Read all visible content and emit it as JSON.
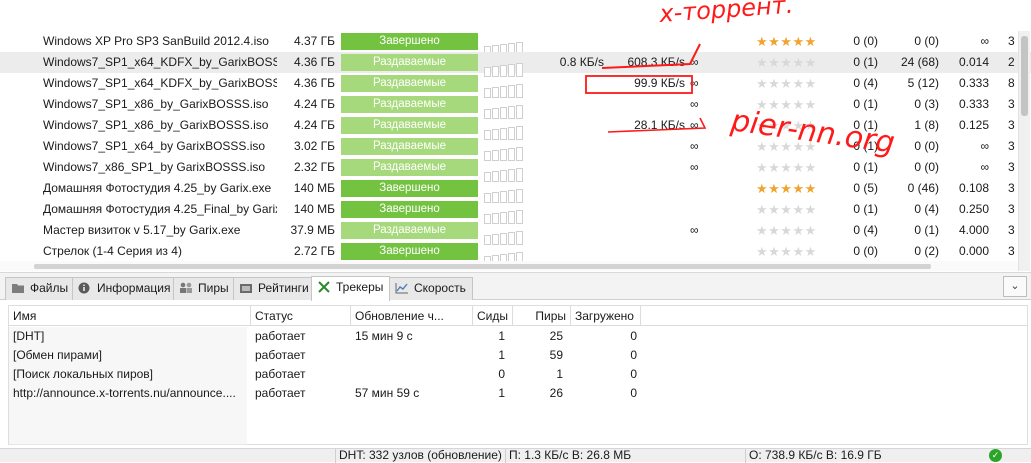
{
  "torrents": [
    {
      "name": "Windows XP Pro SP3 SanBuild 2012.4.iso",
      "size": "4.37 ГБ",
      "status": "Завершено",
      "status_kind": "done",
      "down": "",
      "up": "",
      "eta": "",
      "rating": "★★★★★",
      "rating_on": true,
      "seeds": "0 (0)",
      "peers": "0 (0)",
      "ratio": "∞",
      "extra": "3"
    },
    {
      "name": "Windows7_SP1_x64_KDFX_by_GarixBOSSS.iso",
      "size": "4.36 ГБ",
      "status": "Раздаваемые",
      "status_kind": "seed",
      "down": "0.8 КБ/s",
      "up": "608.3 КБ/s",
      "eta": "∞",
      "rating": "★★★★★",
      "rating_on": false,
      "seeds": "0 (1)",
      "peers": "24 (68)",
      "ratio": "0.014",
      "extra": "2"
    },
    {
      "name": "Windows7_SP1_x64_KDFX_by_GarixBOSSS.iso",
      "size": "4.36 ГБ",
      "status": "Раздаваемые",
      "status_kind": "seed",
      "down": "",
      "up": "99.9 КБ/s",
      "eta": "∞",
      "rating": "★★★★★",
      "rating_on": false,
      "seeds": "0 (4)",
      "peers": "5 (12)",
      "ratio": "0.333",
      "extra": "8"
    },
    {
      "name": "Windows7_SP1_x86_by_GarixBOSSS.iso",
      "size": "4.24 ГБ",
      "status": "Раздаваемые",
      "status_kind": "seed",
      "down": "",
      "up": "",
      "eta": "∞",
      "rating": "★★★★★",
      "rating_on": false,
      "seeds": "0 (1)",
      "peers": "0 (3)",
      "ratio": "0.333",
      "extra": "3"
    },
    {
      "name": "Windows7_SP1_x86_by_GarixBOSSS.iso",
      "size": "4.24 ГБ",
      "status": "Раздаваемые",
      "status_kind": "seed",
      "down": "",
      "up": "28.1 КБ/s",
      "eta": "∞",
      "rating": "★★★★★",
      "rating_on": false,
      "seeds": "0 (1)",
      "peers": "1 (8)",
      "ratio": "0.125",
      "extra": "3"
    },
    {
      "name": "Windows7_SP1_x64_by GarixBOSSS.iso",
      "size": "3.02 ГБ",
      "status": "Раздаваемые",
      "status_kind": "seed",
      "down": "",
      "up": "",
      "eta": "∞",
      "rating": "★★★★★",
      "rating_on": false,
      "seeds": "0 (1)",
      "peers": "0 (0)",
      "ratio": "∞",
      "extra": "3"
    },
    {
      "name": "Windows7_x86_SP1_by GarixBOSSS.iso",
      "size": "2.32 ГБ",
      "status": "Раздаваемые",
      "status_kind": "seed",
      "down": "",
      "up": "",
      "eta": "∞",
      "rating": "★★★★★",
      "rating_on": false,
      "seeds": "0 (1)",
      "peers": "0 (0)",
      "ratio": "∞",
      "extra": "3"
    },
    {
      "name": "Домашняя Фотостудия 4.25_by Garix.exe",
      "size": "140 МБ",
      "status": "Завершено",
      "status_kind": "done",
      "down": "",
      "up": "",
      "eta": "",
      "rating": "★★★★★",
      "rating_on": true,
      "seeds": "0 (5)",
      "peers": "0 (46)",
      "ratio": "0.108",
      "extra": "3"
    },
    {
      "name": "Домашняя Фотостудия 4.25_Final_by Garix.exe",
      "size": "140 МБ",
      "status": "Завершено",
      "status_kind": "done",
      "down": "",
      "up": "",
      "eta": "",
      "rating": "★★★★★",
      "rating_on": false,
      "seeds": "0 (1)",
      "peers": "0 (4)",
      "ratio": "0.250",
      "extra": "3"
    },
    {
      "name": "Мастер визиток v 5.17_by Garix.exe",
      "size": "37.9 МБ",
      "status": "Раздаваемые",
      "status_kind": "seed",
      "down": "",
      "up": "",
      "eta": "∞",
      "rating": "★★★★★",
      "rating_on": false,
      "seeds": "0 (4)",
      "peers": "0 (1)",
      "ratio": "4.000",
      "extra": "3"
    },
    {
      "name": "Стрелок (1-4 Серия из 4)",
      "size": "2.72 ГБ",
      "status": "Завершено",
      "status_kind": "done",
      "down": "",
      "up": "",
      "eta": "",
      "rating": "★★★★★",
      "rating_on": false,
      "seeds": "0 (0)",
      "peers": "0 (2)",
      "ratio": "0.000",
      "extra": "3"
    }
  ],
  "tabs": [
    {
      "label": "Файлы",
      "icon": "folder-icon"
    },
    {
      "label": "Информация",
      "icon": "info-icon"
    },
    {
      "label": "Пиры",
      "icon": "peers-icon"
    },
    {
      "label": "Рейтинги",
      "icon": "ratings-icon"
    },
    {
      "label": "Трекеры",
      "icon": "trackers-icon",
      "active": true
    },
    {
      "label": "Скорость",
      "icon": "speed-chart-icon"
    }
  ],
  "trackers": {
    "columns": [
      "Имя",
      "Статус",
      "Обновление ч...",
      "Сиды",
      "Пиры",
      "Загружено"
    ],
    "rows": [
      {
        "name": "[DHT]",
        "status": "работает",
        "update": "15 мин 9 с",
        "seeds": "1",
        "peers": "25",
        "downloaded": "0"
      },
      {
        "name": "[Обмен пирами]",
        "status": "работает",
        "update": "",
        "seeds": "1",
        "peers": "59",
        "downloaded": "0"
      },
      {
        "name": "[Поиск локальных пиров]",
        "status": "работает",
        "update": "",
        "seeds": "0",
        "peers": "1",
        "downloaded": "0"
      },
      {
        "name": "http://announce.x-torrents.nu/announce....",
        "status": "работает",
        "update": "57 мин 59 с",
        "seeds": "1",
        "peers": "26",
        "downloaded": "0"
      }
    ]
  },
  "statusbar": {
    "dht": "DHT: 332 узлов  (обновление)",
    "download": "П: 1.3 КБ/с В: 26.8 МБ",
    "upload": "О: 738.9 КБ/с В: 16.9 ГБ"
  },
  "annotations": {
    "top": "x-торрент.",
    "middle": "pier-nn.org"
  },
  "colors": {
    "status_done": "#73c341",
    "status_seed": "#a6d97c",
    "rating_star": "#f0a32e",
    "ink": "#ff1a1a"
  }
}
